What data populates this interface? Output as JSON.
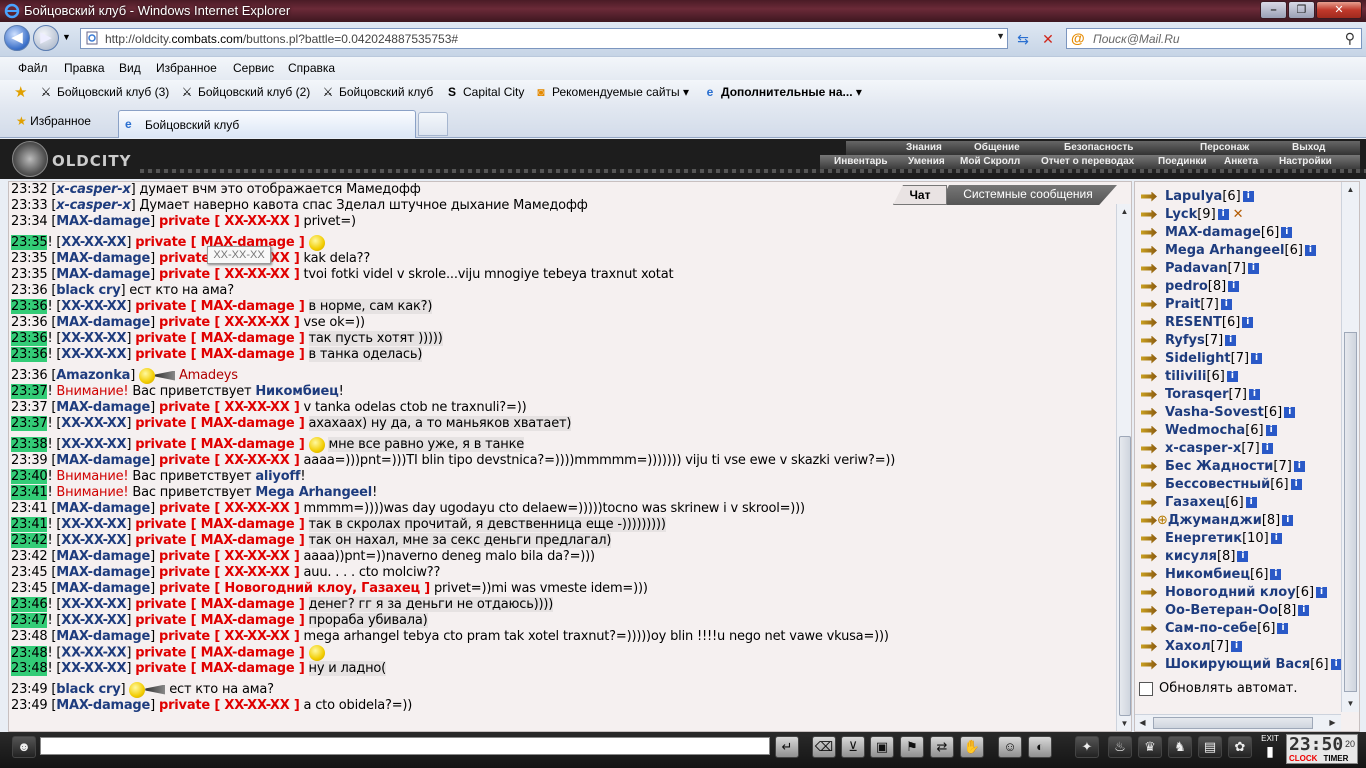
{
  "window": {
    "title": "Бойцовский клуб - Windows Internet Explorer",
    "url_prefix": "http://oldcity.",
    "url_domain": "combats.com",
    "url_rest": "/buttons.pl?battle=0.042024887535753#",
    "search_placeholder": "Поиск@Mail.Ru",
    "min": "–",
    "max": "❐",
    "close": "✕"
  },
  "menu": [
    "Файл",
    "Правка",
    "Вид",
    "Избранное",
    "Сервис",
    "Справка"
  ],
  "favbar": [
    {
      "label": "Бойцовский клуб (3)",
      "icon": "swords-icon"
    },
    {
      "label": "Бойцовский клуб (2)",
      "icon": "swords-icon"
    },
    {
      "label": "Бойцовский клуб",
      "icon": "swords-icon"
    },
    {
      "label": "Capital City",
      "icon": "s-icon"
    },
    {
      "label": "Рекомендуемые сайты ▾",
      "icon": "rss-icon"
    },
    {
      "label": "Дополнительные на... ▾",
      "icon": "ie-icon"
    }
  ],
  "tabs": {
    "favorites": "Избранное",
    "active": "Бойцовский клуб"
  },
  "game": {
    "logo": "OLDCITY",
    "nav1": [
      "Знания",
      "Общение",
      "Безопасность",
      "Персонаж",
      "Выход"
    ],
    "nav2": [
      "Инвентарь",
      "Умения",
      "Мой Скролл",
      "Отчет о переводах",
      "Поединки",
      "Анкета",
      "Настройки"
    ]
  },
  "chat": {
    "tab_chat": "Чат",
    "tab_system": "Системные сообщения",
    "tooltip": "XX-XX-XX",
    "lines": [
      {
        "ts": "23:32",
        "hl": false,
        "nick": "x-casper-x",
        "italic": true,
        "priv": "",
        "text": "думает вчм это отображается Мамедофф"
      },
      {
        "ts": "23:33",
        "hl": false,
        "nick": "x-casper-x",
        "italic": true,
        "priv": "",
        "text": "Думает наверно кавота спас Зделал штучное дыхание Мамедофф"
      },
      {
        "ts": "23:34",
        "hl": false,
        "nick": "MAX-damage",
        "priv": "private [ XX-XX-XX ]",
        "text": "privet=)"
      },
      {
        "ts": "23:35",
        "hl": true,
        "nick": "XX-XX-XX",
        "priv": "private [ MAX-damage ]",
        "text": "",
        "tall": true,
        "emoji": true
      },
      {
        "ts": "23:35",
        "hl": false,
        "nick": "MAX-damage",
        "priv": "private [ XX-XX-XX ]",
        "text": "kak dela??"
      },
      {
        "ts": "23:35",
        "hl": false,
        "nick": "MAX-damage",
        "priv": "private [ XX-XX-XX ]",
        "text": "tvoi fotki videl v skrole...viju mnogiye tebeya traxnut xotat"
      },
      {
        "ts": "23:36",
        "hl": false,
        "nick": "black cry",
        "priv": "",
        "text": "ест кто на ама?"
      },
      {
        "ts": "23:36",
        "hl": true,
        "nick": "XX-XX-XX",
        "priv": "private [ MAX-damage ]",
        "text": "в норме, сам как?)"
      },
      {
        "ts": "23:36",
        "hl": false,
        "nick": "MAX-damage",
        "priv": "private [ XX-XX-XX ]",
        "text": "vse ok=))"
      },
      {
        "ts": "23:36",
        "hl": true,
        "nick": "XX-XX-XX",
        "priv": "private [ MAX-damage ]",
        "text": "так пусть хотят )))))"
      },
      {
        "ts": "23:36",
        "hl": true,
        "nick": "XX-XX-XX",
        "priv": "private [ MAX-damage ]",
        "text": "в танка оделась)"
      },
      {
        "ts": "23:36",
        "hl": false,
        "nick": "Amazonka",
        "priv": "",
        "text": "Amadeys",
        "tall": true,
        "emoji": true,
        "cone": true,
        "red": true
      },
      {
        "ts": "23:37",
        "hl": true,
        "warn": "Внимание!",
        "text": "Вас приветствует",
        "nick2": "Никомбиец",
        "tail": "!"
      },
      {
        "ts": "23:37",
        "hl": false,
        "nick": "MAX-damage",
        "priv": "private [ XX-XX-XX ]",
        "text": "v tanka odelas ctob ne traxnuli?=))"
      },
      {
        "ts": "23:37",
        "hl": true,
        "nick": "XX-XX-XX",
        "priv": "private [ MAX-damage ]",
        "text": "ахахаах) ну да, а то маньяков хватает)"
      },
      {
        "ts": "23:38",
        "hl": true,
        "nick": "XX-XX-XX",
        "priv": "private [ MAX-damage ]",
        "text": "мне все равно уже, я в танке",
        "tall": true,
        "emoji": true
      },
      {
        "ts": "23:39",
        "hl": false,
        "nick": "MAX-damage",
        "priv": "private [ XX-XX-XX ]",
        "text": "aaaa=)))pnt=)))TI blin tipo devstnica?=))))mmmmm=))))))) viju ti vse ewe v skazki veriw?=))"
      },
      {
        "ts": "23:40",
        "hl": true,
        "warn": "Внимание!",
        "text": "Вас приветствует",
        "nick2": "aliyoff",
        "tail": "!"
      },
      {
        "ts": "23:41",
        "hl": true,
        "warn": "Внимание!",
        "text": "Вас приветствует",
        "nick2": "Mega Arhangeel",
        "tail": "!"
      },
      {
        "ts": "23:41",
        "hl": false,
        "nick": "MAX-damage",
        "priv": "private [ XX-XX-XX ]",
        "text": "mmmm=))))was day ugodayu cto delaew=)))))tocno was skrinew i v skrool=)))"
      },
      {
        "ts": "23:41",
        "hl": true,
        "nick": "XX-XX-XX",
        "priv": "private [ MAX-damage ]",
        "text": "так в скролах прочитай, я девственница еще -)))))))))"
      },
      {
        "ts": "23:42",
        "hl": true,
        "nick": "XX-XX-XX",
        "priv": "private [ MAX-damage ]",
        "text": "так он нахал, мне за секс деньги предлагал)"
      },
      {
        "ts": "23:42",
        "hl": false,
        "nick": "MAX-damage",
        "priv": "private [ XX-XX-XX ]",
        "text": "aaaa))pnt=))naverno deneg malo bila da?=)))"
      },
      {
        "ts": "23:45",
        "hl": false,
        "nick": "MAX-damage",
        "priv": "private [ XX-XX-XX ]",
        "text": "auu. . . . cto molciw??"
      },
      {
        "ts": "23:45",
        "hl": false,
        "nick": "MAX-damage",
        "priv": "private [ Новогодний клоу, Газахец ]",
        "text": "privet=))mi was vmeste idem=)))"
      },
      {
        "ts": "23:46",
        "hl": true,
        "nick": "XX-XX-XX",
        "priv": "private [ MAX-damage ]",
        "text": "денег? гг я за деньги не отдаюсь))))"
      },
      {
        "ts": "23:47",
        "hl": true,
        "nick": "XX-XX-XX",
        "priv": "private [ MAX-damage ]",
        "text": "прораба убивала)"
      },
      {
        "ts": "23:48",
        "hl": false,
        "nick": "MAX-damage",
        "priv": "private [ XX-XX-XX ]",
        "text": "mega arhangel tebya cto pram tak xotel traxnut?=)))))oy blin !!!!u nego net vawe vkusa=)))"
      },
      {
        "ts": "23:48",
        "hl": true,
        "nick": "XX-XX-XX",
        "priv": "private [ MAX-damage ]",
        "text": "",
        "emoji": true
      },
      {
        "ts": "23:48",
        "hl": true,
        "nick": "XX-XX-XX",
        "priv": "private [ MAX-damage ]",
        "text": "ну и ладно("
      },
      {
        "ts": "23:49",
        "hl": false,
        "nick": "black cry",
        "priv": "",
        "text": "ест кто на ама?",
        "tall": true,
        "emoji": true,
        "cone": true
      },
      {
        "ts": "23:49",
        "hl": false,
        "nick": "MAX-damage",
        "priv": "private [ XX-XX-XX ]",
        "text": "a cto obidela?=))"
      }
    ]
  },
  "users": [
    {
      "name": "Lapulya",
      "level": "[6]"
    },
    {
      "name": "Lyck",
      "level": "[9]",
      "swords": true
    },
    {
      "name": "MAX-damage",
      "level": "[6]"
    },
    {
      "name": "Mega Arhangeel",
      "level": "[6]"
    },
    {
      "name": "Padavan",
      "level": "[7]"
    },
    {
      "name": "pedro",
      "level": "[8]"
    },
    {
      "name": "Prait",
      "level": "[7]"
    },
    {
      "name": "RESENT",
      "level": "[6]"
    },
    {
      "name": "Ryfys",
      "level": "[7]"
    },
    {
      "name": "Sidelight",
      "level": "[7]"
    },
    {
      "name": "tilivili",
      "level": "[6]"
    },
    {
      "name": "Torasqer",
      "level": "[7]"
    },
    {
      "name": "Vasha-Sovest",
      "level": "[6]"
    },
    {
      "name": "Wedmocha",
      "level": "[6]"
    },
    {
      "name": "x-casper-x",
      "level": "[7]"
    },
    {
      "name": "Бес Жадности",
      "level": "[7]"
    },
    {
      "name": "Бессовестный",
      "level": "[6]"
    },
    {
      "name": "Газахец",
      "level": "[6]"
    },
    {
      "name": "Джуманджи",
      "level": "[8]",
      "plus": true
    },
    {
      "name": "Енергетик",
      "level": "[10]"
    },
    {
      "name": "кисуля",
      "level": "[8]"
    },
    {
      "name": "Никомбиец",
      "level": "[6]"
    },
    {
      "name": "Новогодний клоу",
      "level": "[6]"
    },
    {
      "name": "Оо-Ветеран-Оо",
      "level": "[8]"
    },
    {
      "name": "Сам-по-себе",
      "level": "[6]"
    },
    {
      "name": "Хахол",
      "level": "[7]"
    },
    {
      "name": "Шокирующий Вася",
      "level": "[6]"
    }
  ],
  "auto_update_label": "Обновлять автомат.",
  "clock": {
    "time": "23:50",
    "sec": "20",
    "clock_label": "CLOCK",
    "timer_label": "TIMER",
    "exit": "EXIT"
  }
}
